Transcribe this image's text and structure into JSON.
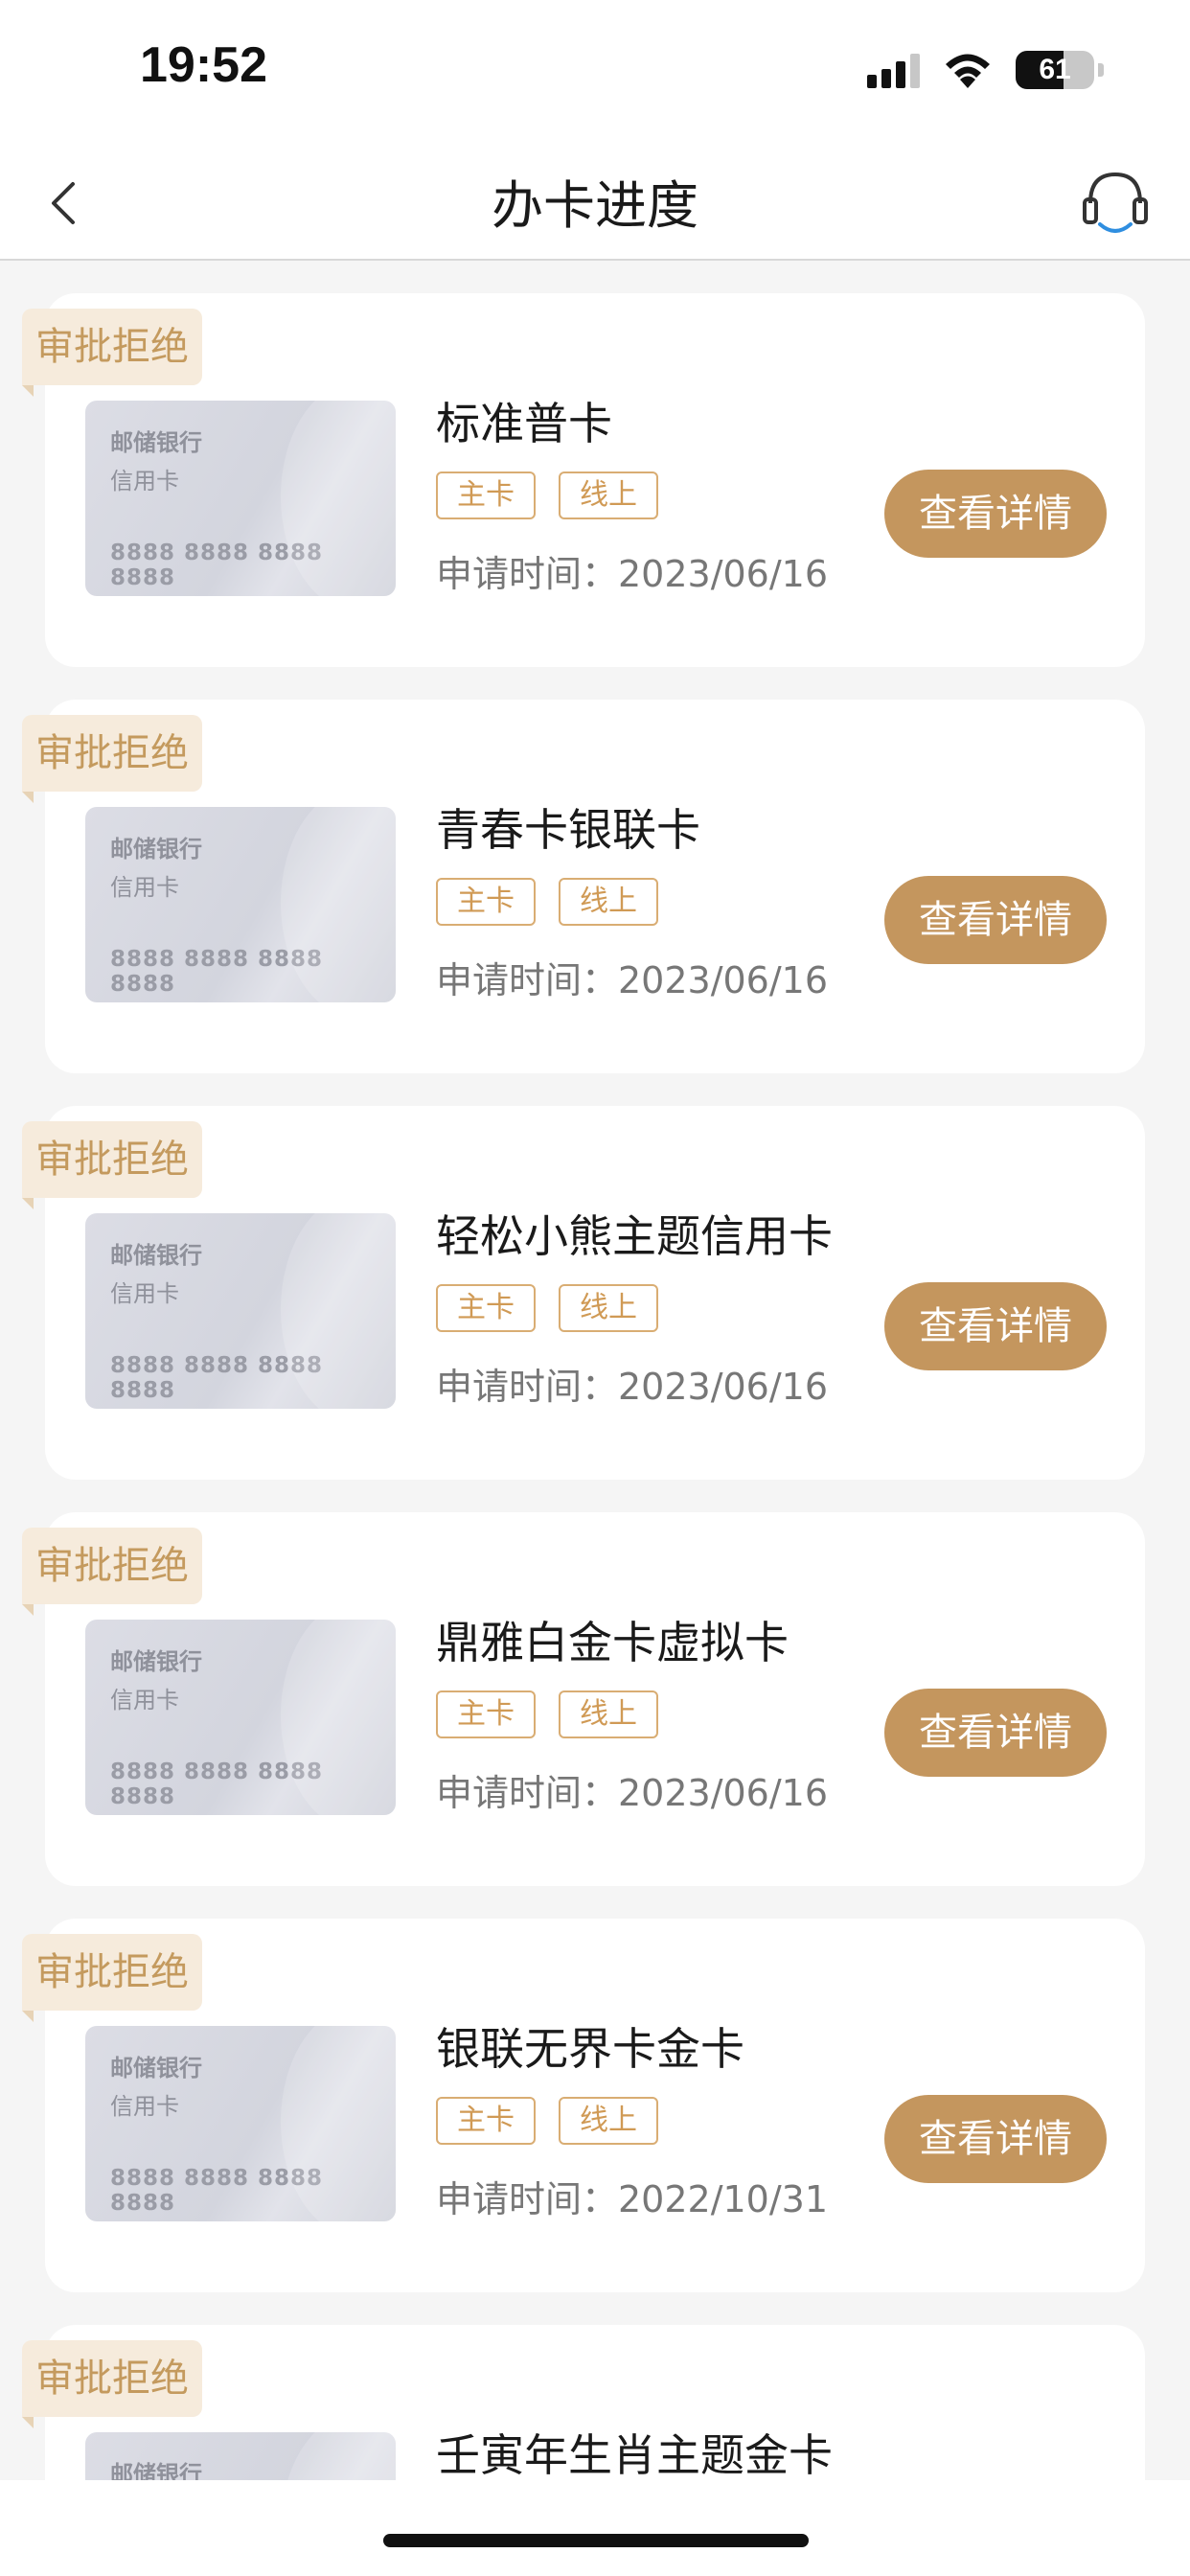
{
  "status_bar": {
    "time": "19:52",
    "battery": "61"
  },
  "nav": {
    "title": "办卡进度",
    "back_icon": "chevron-left-icon",
    "service_icon": "headset-icon"
  },
  "applications": [
    {
      "status": "审批拒绝",
      "bank": "邮储银行",
      "card_type": "信用卡",
      "card_number": "8888 8888 8888 8888",
      "name": "标准普卡",
      "tags": [
        "主卡",
        "线上"
      ],
      "date_label": "申请时间：2023/06/16",
      "button": "查看详情"
    },
    {
      "status": "审批拒绝",
      "bank": "邮储银行",
      "card_type": "信用卡",
      "card_number": "8888 8888 8888 8888",
      "name": "青春卡银联卡",
      "tags": [
        "主卡",
        "线上"
      ],
      "date_label": "申请时间：2023/06/16",
      "button": "查看详情"
    },
    {
      "status": "审批拒绝",
      "bank": "邮储银行",
      "card_type": "信用卡",
      "card_number": "8888 8888 8888 8888",
      "name": "轻松小熊主题信用卡",
      "tags": [
        "主卡",
        "线上"
      ],
      "date_label": "申请时间：2023/06/16",
      "button": "查看详情"
    },
    {
      "status": "审批拒绝",
      "bank": "邮储银行",
      "card_type": "信用卡",
      "card_number": "8888 8888 8888 8888",
      "name": "鼎雅白金卡虚拟卡",
      "tags": [
        "主卡",
        "线上"
      ],
      "date_label": "申请时间：2023/06/16",
      "button": "查看详情"
    },
    {
      "status": "审批拒绝",
      "bank": "邮储银行",
      "card_type": "信用卡",
      "card_number": "8888 8888 8888 8888",
      "name": "银联无界卡金卡",
      "tags": [
        "主卡",
        "线上"
      ],
      "date_label": "申请时间：2022/10/31",
      "button": "查看详情"
    },
    {
      "status": "审批拒绝",
      "bank": "邮储银行",
      "card_type": "",
      "card_number": "",
      "name": "壬寅年生肖主题金卡",
      "tags": [],
      "date_label": "",
      "button": ""
    }
  ],
  "colors": {
    "accent": "#c4965e",
    "tag_bg": "#f6ebdc",
    "tag_text": "#c49a5e",
    "background": "#f5f5f5"
  }
}
